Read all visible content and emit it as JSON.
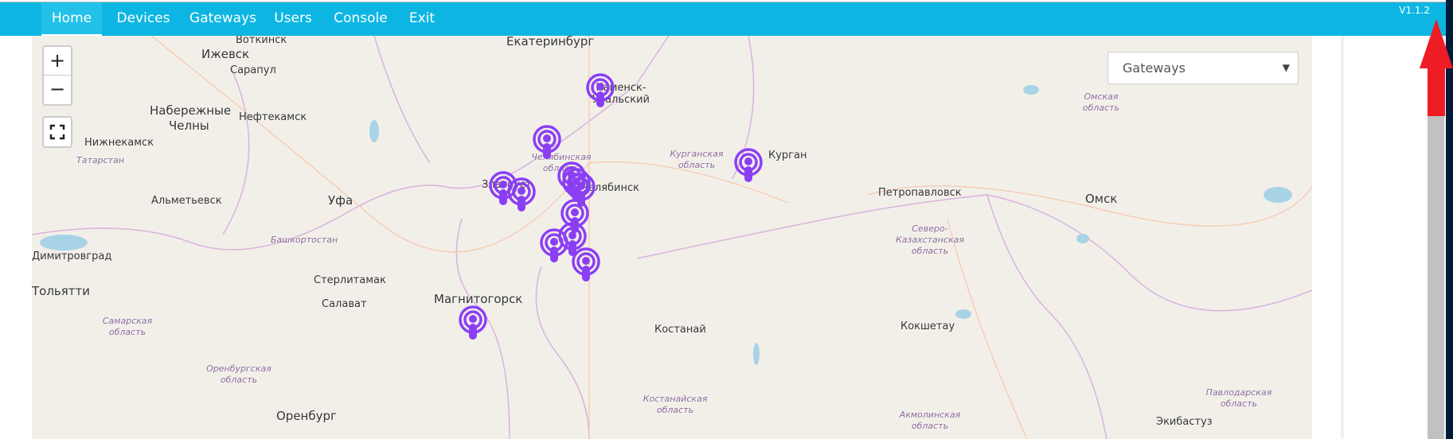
{
  "nav": {
    "items": [
      {
        "label": "Home",
        "active": true
      },
      {
        "label": "Devices"
      },
      {
        "label": "Gateways"
      },
      {
        "label": "Users"
      },
      {
        "label": "Console"
      },
      {
        "label": "Exit"
      }
    ],
    "version": "V1.1.2",
    "color": "#0db6e2"
  },
  "map": {
    "zoom_in": "+",
    "zoom_out": "−",
    "fullscreen_icon": "fullscreen-icon",
    "layer_select": {
      "value": "Gateways",
      "arrow": "▼"
    },
    "marker_icon": "gateway-antenna-icon",
    "marker_color": "#8b3ff5",
    "cities": [
      "Екатеринбург",
      "Воткинск",
      "Ижевск",
      "Сарапул",
      "Набережные",
      "Челны",
      "Нефтекамск",
      "Нижнекамск",
      "Альметьевск",
      "Уфа",
      "Димитровград",
      "Стерлитамак",
      "Салават",
      "Тольятти",
      "Магнитогорск",
      "Костанай",
      "Петропавловск",
      "Омск",
      "Кокшетау",
      "Оренбург",
      "Экибастуз",
      "Курган",
      "Каменск-Уральский",
      "Златоуст",
      "Челябинск"
    ],
    "regions": [
      "Татарстан",
      "Башкортостан",
      "Челябинская область",
      "Курганская область",
      "Омская область",
      "Северо-Казахстанская область",
      "Самарская область",
      "Оренбургская область",
      "Костанайская область",
      "Акмолинская область",
      "Павлодарская область"
    ]
  },
  "annotation": {
    "arrow_color": "#ee1c24"
  }
}
